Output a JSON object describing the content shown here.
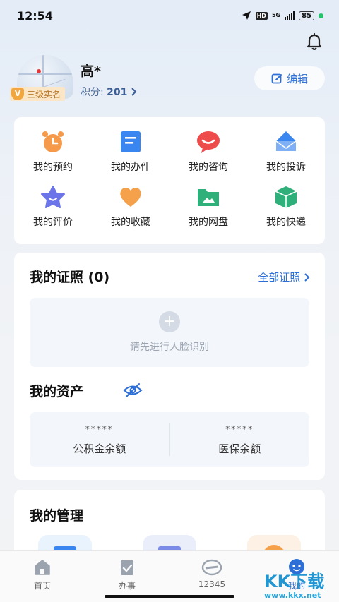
{
  "status": {
    "time": "12:54",
    "network": "5G",
    "hd": "HD",
    "battery": "85"
  },
  "profile": {
    "name": "高*",
    "badge": "三级实名",
    "points_label": "积分:",
    "points_value": "201",
    "edit_label": "编辑"
  },
  "services": [
    {
      "label": "我的预约",
      "icon": "alarm-clock-icon",
      "color": "#f59a4a"
    },
    {
      "label": "我的办件",
      "icon": "document-icon",
      "color": "#3a86f0"
    },
    {
      "label": "我的咨询",
      "icon": "chat-bubble-icon",
      "color": "#ee4b4b"
    },
    {
      "label": "我的投诉",
      "icon": "envelope-icon",
      "color": "#3a86f0"
    },
    {
      "label": "我的评价",
      "icon": "star-icon",
      "color": "#6b74e8"
    },
    {
      "label": "我的收藏",
      "icon": "heart-icon",
      "color": "#f5a04a"
    },
    {
      "label": "我的网盘",
      "icon": "folder-icon",
      "color": "#2fb07a"
    },
    {
      "label": "我的快递",
      "icon": "package-icon",
      "color": "#2fb07a"
    }
  ],
  "certificates": {
    "title": "我的证照 (0)",
    "all_link": "全部证照",
    "empty_hint": "请先进行人脸识别"
  },
  "assets": {
    "title": "我的资产",
    "items": [
      {
        "value": "*****",
        "label": "公积金余额"
      },
      {
        "value": "*****",
        "label": "医保余额"
      }
    ]
  },
  "management": {
    "title": "我的管理"
  },
  "tabs": [
    {
      "label": "首页",
      "icon": "home-icon"
    },
    {
      "label": "办事",
      "icon": "clipboard-check-icon"
    },
    {
      "label": "12345",
      "icon": "hotline-12345-icon"
    },
    {
      "label": "我的",
      "icon": "my-profile-icon"
    }
  ],
  "watermark": {
    "brand": "KK下载",
    "url": "www.kkx.net"
  }
}
